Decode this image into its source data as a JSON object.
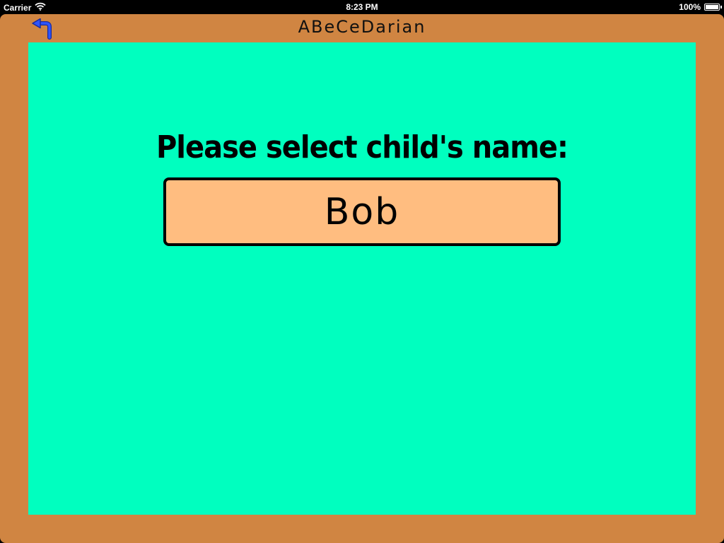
{
  "status_bar": {
    "carrier": "Carrier",
    "time": "8:23 PM",
    "battery_text": "100%",
    "battery_level": 1.0,
    "wifi_icon": "wifi-icon",
    "battery_icon": "battery-icon"
  },
  "header": {
    "title": "ABeCeDarian",
    "back_icon": "back-arrow-icon",
    "back_icon_color": "#2233cc"
  },
  "main": {
    "prompt": "Please select child's name:",
    "names": [
      {
        "label": "Bob"
      }
    ]
  },
  "colors": {
    "frame": "#d08542",
    "board": "#00ffbf",
    "name_button": "#ffbd80",
    "text": "#000000"
  }
}
